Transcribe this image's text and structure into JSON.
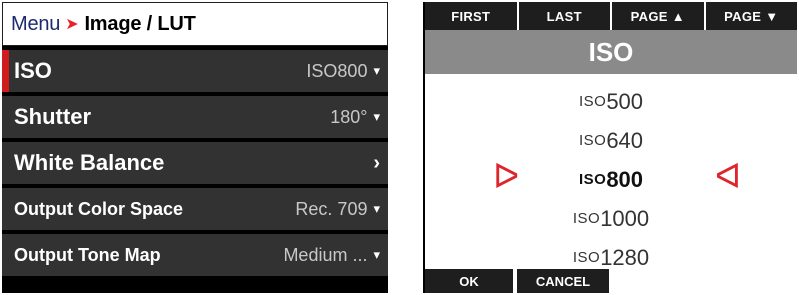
{
  "left": {
    "breadcrumb": {
      "menu": "Menu",
      "separator": "➤",
      "current": "Image / LUT"
    },
    "rows": [
      {
        "label": "ISO",
        "value_prefix": "ISO",
        "value_number": "800",
        "indicator": "▾"
      },
      {
        "label": "Shutter",
        "value": "180°",
        "indicator": "▾"
      },
      {
        "label": "White Balance",
        "indicator": "›"
      },
      {
        "label": "Output Color Space",
        "value": "Rec. 709",
        "indicator": "▾"
      },
      {
        "label": "Output Tone Map",
        "value": "Medium ...",
        "indicator": "▾"
      }
    ]
  },
  "right": {
    "pager": {
      "first": "FIRST",
      "last": "LAST",
      "page_up": "PAGE",
      "page_up_icon": "▲",
      "page_down": "PAGE",
      "page_down_icon": "▼"
    },
    "title": "ISO",
    "options": [
      {
        "prefix": "ISO",
        "number": "500"
      },
      {
        "prefix": "ISO",
        "number": "640"
      },
      {
        "prefix": "ISO",
        "number": "800"
      },
      {
        "prefix": "ISO",
        "number": "1000"
      },
      {
        "prefix": "ISO",
        "number": "1280"
      }
    ],
    "selected_index": 2,
    "arrow_left": "ᐅ",
    "arrow_right": "ᐊ",
    "ok": "OK",
    "cancel": "CANCEL"
  },
  "colors": {
    "accent_red": "#d01c1c",
    "row_bg": "#323232",
    "title_bar": "#8a8a8a"
  }
}
